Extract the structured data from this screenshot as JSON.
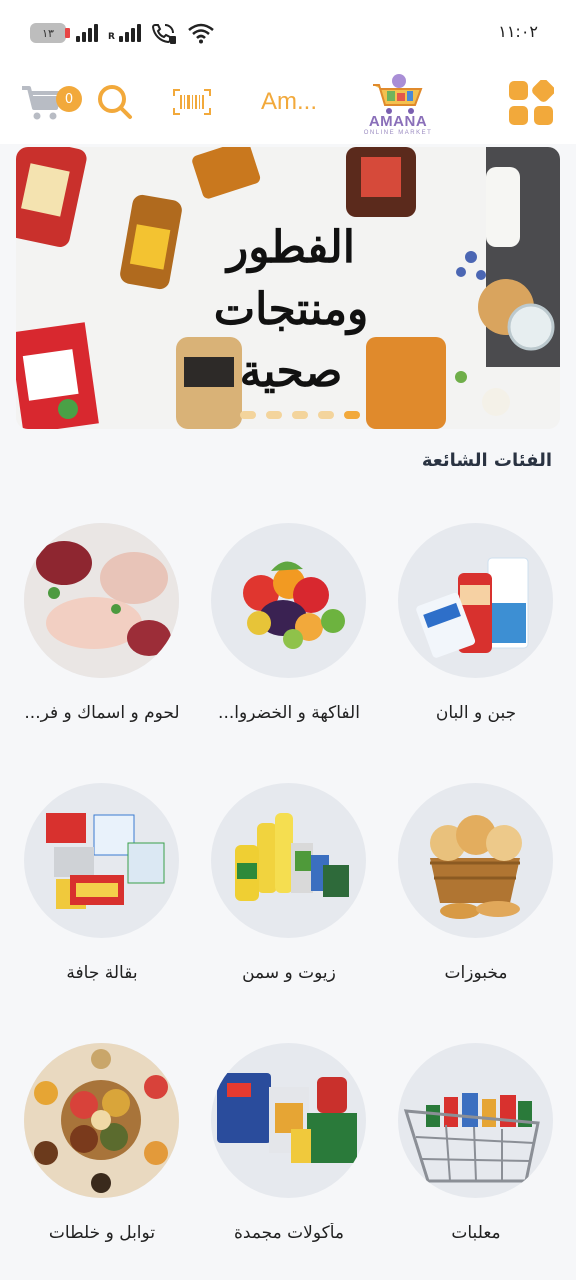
{
  "status_bar": {
    "time": "١١:٠٢",
    "battery": "١٣",
    "network_label": "R"
  },
  "header": {
    "cart_count": "0",
    "language_label": "Am...",
    "logo_name": "AMANA",
    "logo_tagline": "ONLINE MARKET"
  },
  "banner": {
    "title_line1": "الفطور ومنتجات",
    "title_line2": "صحية",
    "dot_count": 5,
    "active_dot": 4
  },
  "section": {
    "title": "الفئات الشائعة"
  },
  "categories": [
    {
      "label": "جبن و البان",
      "icon": "dairy-products"
    },
    {
      "label": "الفاكهة و الخضروا...",
      "icon": "fruits-vegetables"
    },
    {
      "label": "لحوم و اسماك و فر...",
      "icon": "meat-fish-poultry"
    },
    {
      "label": "مخبوزات",
      "icon": "bakery-basket"
    },
    {
      "label": "زيوت و سمن",
      "icon": "oil-bottles"
    },
    {
      "label": "بقالة جافة",
      "icon": "dry-groceries"
    },
    {
      "label": "معلبات",
      "icon": "canned-food-cart"
    },
    {
      "label": "مأكولات مجمدة",
      "icon": "frozen-food"
    },
    {
      "label": "توابل و خلطات",
      "icon": "spices"
    }
  ],
  "colors": {
    "accent": "#f2a93b",
    "logo_purple": "#8a6fb9",
    "title_text": "#2a3342",
    "background": "#f6f7f9"
  }
}
